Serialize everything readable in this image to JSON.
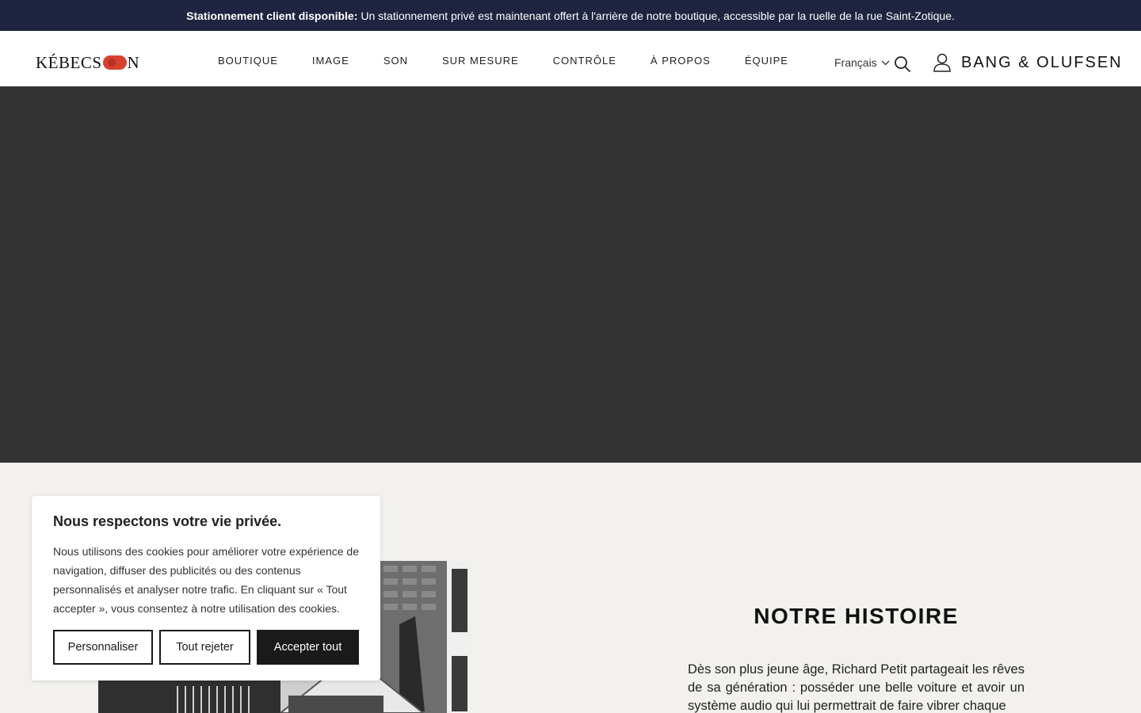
{
  "announcement": {
    "bold": "Stationnement client disponible:",
    "text": "Un stationnement privé est maintenant offert à l'arrière de notre boutique, accessible par la ruelle de la rue Saint-Zotique."
  },
  "header": {
    "logo_left": "KÉBEC",
    "logo_s": "S",
    "logo_right": "N",
    "nav": [
      {
        "label": "BOUTIQUE"
      },
      {
        "label": "IMAGE"
      },
      {
        "label": "SON"
      },
      {
        "label": "SUR MESURE"
      },
      {
        "label": "CONTRÔLE"
      },
      {
        "label": "À PROPOS"
      },
      {
        "label": "ÉQUIPE"
      }
    ],
    "language": "Français",
    "partner_logo": "BANG & OLUFSEN"
  },
  "story": {
    "title": "NOTRE HISTOIRE",
    "body": "Dès son plus jeune âge, Richard Petit partageait les rêves de sa génération : posséder une belle voiture et avoir un système audio qui lui permettrait de faire vibrer chaque"
  },
  "cookie_banner": {
    "title": "Nous respectons votre vie privée.",
    "text": "Nous utilisons des cookies pour améliorer votre expérience de navigation, diffuser des publicités ou des contenus personnalisés et analyser notre trafic. En cliquant sur « Tout accepter », vous consentez à notre utilisation des cookies.",
    "customize_label": "Personnaliser",
    "reject_label": "Tout rejeter",
    "accept_label": "Accepter tout"
  },
  "colors": {
    "announcement_bg": "#1f2540",
    "hero_bg": "#333333",
    "page_bg": "#f2f1ee",
    "brand_red": "#d8402f"
  }
}
